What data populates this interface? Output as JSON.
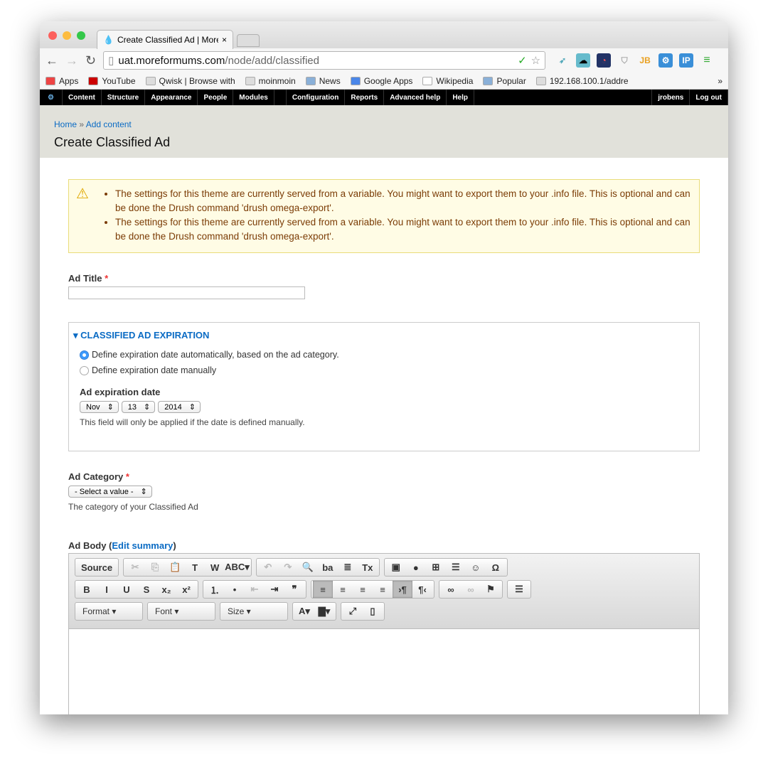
{
  "browser": {
    "tab_title": "Create Classified Ad | MoreForMums",
    "url_host": "uat.moreformums.com",
    "url_path": "/node/add/classified",
    "bookmarks": [
      {
        "label": "Apps",
        "color": "#e44"
      },
      {
        "label": "YouTube",
        "color": "#c00"
      },
      {
        "label": "Qwisk | Browse with",
        "color": "#ddd"
      },
      {
        "label": "moinmoin",
        "color": "#ddd"
      },
      {
        "label": "News",
        "color": "#8ab0d8"
      },
      {
        "label": "Google Apps",
        "color": "#4a86e8"
      },
      {
        "label": "Wikipedia",
        "color": "#fff"
      },
      {
        "label": "Popular",
        "color": "#8ab0d8"
      },
      {
        "label": "192.168.100.1/addre",
        "color": "#ddd"
      }
    ],
    "overflow": "»"
  },
  "admin": {
    "items": [
      "Content",
      "Structure",
      "Appearance",
      "People",
      "Modules",
      "Configuration",
      "Reports",
      "Advanced help",
      "Help"
    ],
    "user": "jrobens",
    "logout": "Log out"
  },
  "header": {
    "home": "Home",
    "sep": " » ",
    "add_content": "Add content",
    "title": "Create Classified Ad"
  },
  "messages": [
    "The settings for this theme are currently served from a variable. You might want to export them to your .info file. This is optional and can be done the Drush command 'drush omega-export'.",
    "The settings for this theme are currently served from a variable. You might want to export them to your .info file. This is optional and can be done the Drush command 'drush omega-export'."
  ],
  "form": {
    "title_label": "Ad Title",
    "req": "*",
    "expiration": {
      "legend": "CLASSIFIED AD EXPIRATION",
      "opt_auto": "Define expiration date automatically, based on the ad category.",
      "opt_manual": "Define expiration date manually",
      "selected": "auto",
      "date_label": "Ad expiration date",
      "month": "Nov",
      "day": "13",
      "year": "2014",
      "desc": "This field will only be applied if the date is defined manually."
    },
    "category": {
      "label": "Ad Category",
      "value": "- Select a value -",
      "desc": "The category of your Classified Ad"
    },
    "body": {
      "label": "Ad Body (",
      "edit_summary": "Edit summary",
      "close": ")"
    }
  },
  "editor": {
    "rows": [
      [
        [
          {
            "g": "Source",
            "n": "source"
          }
        ],
        [
          {
            "g": "✂",
            "n": "cut",
            "d": 1
          },
          {
            "g": "⎘",
            "n": "copy",
            "d": 1
          },
          {
            "g": "📋",
            "n": "paste"
          },
          {
            "g": "T",
            "n": "paste-text"
          },
          {
            "g": "W",
            "n": "paste-word"
          },
          {
            "g": "ABC▾",
            "n": "spellcheck"
          }
        ],
        [
          {
            "g": "↶",
            "n": "undo",
            "d": 1
          },
          {
            "g": "↷",
            "n": "redo",
            "d": 1
          },
          {
            "g": "🔍",
            "n": "find"
          },
          {
            "g": "ba",
            "n": "replace"
          },
          {
            "g": "≣",
            "n": "select-all"
          },
          {
            "g": "Tx",
            "n": "remove-format"
          }
        ],
        [
          {
            "g": "▣",
            "n": "image"
          },
          {
            "g": "●",
            "n": "flash"
          },
          {
            "g": "⊞",
            "n": "table"
          },
          {
            "g": "☰",
            "n": "horizontal-rule"
          },
          {
            "g": "☺",
            "n": "smiley"
          },
          {
            "g": "Ω",
            "n": "special-char"
          }
        ]
      ],
      [
        [
          {
            "g": "B",
            "n": "bold"
          },
          {
            "g": "I",
            "n": "italic"
          },
          {
            "g": "U",
            "n": "underline"
          },
          {
            "g": "S",
            "n": "strike"
          },
          {
            "g": "x₂",
            "n": "subscript"
          },
          {
            "g": "x²",
            "n": "superscript"
          }
        ],
        [
          {
            "g": "⒈",
            "n": "numbered-list"
          },
          {
            "g": "•",
            "n": "bulleted-list"
          },
          {
            "g": "⇤",
            "n": "outdent",
            "d": 1
          },
          {
            "g": "⇥",
            "n": "indent"
          },
          {
            "g": "❞",
            "n": "blockquote"
          }
        ],
        [
          {
            "g": "≡",
            "n": "align-left",
            "o": 1
          },
          {
            "g": "≡",
            "n": "align-center"
          },
          {
            "g": "≡",
            "n": "align-right"
          },
          {
            "g": "≡",
            "n": "justify"
          },
          {
            "g": "›¶",
            "n": "ltr",
            "o": 1
          },
          {
            "g": "¶‹",
            "n": "rtl"
          }
        ],
        [
          {
            "g": "∞",
            "n": "link"
          },
          {
            "g": "∞",
            "n": "unlink",
            "d": 1
          },
          {
            "g": "⚑",
            "n": "anchor"
          }
        ],
        [
          {
            "g": "☰",
            "n": "page-break"
          }
        ]
      ],
      [
        [
          {
            "g": "Format ▾",
            "n": "format",
            "c": 1
          }
        ],
        [
          {
            "g": "Font ▾",
            "n": "font",
            "c": 1
          }
        ],
        [
          {
            "g": "Size ▾",
            "n": "size",
            "c": 1
          }
        ],
        [
          {
            "g": "A▾",
            "n": "text-color"
          },
          {
            "g": "▇▾",
            "n": "bg-color"
          }
        ],
        [
          {
            "g": "⤢",
            "n": "maximize"
          },
          {
            "g": "▯",
            "n": "show-blocks"
          }
        ]
      ]
    ]
  }
}
